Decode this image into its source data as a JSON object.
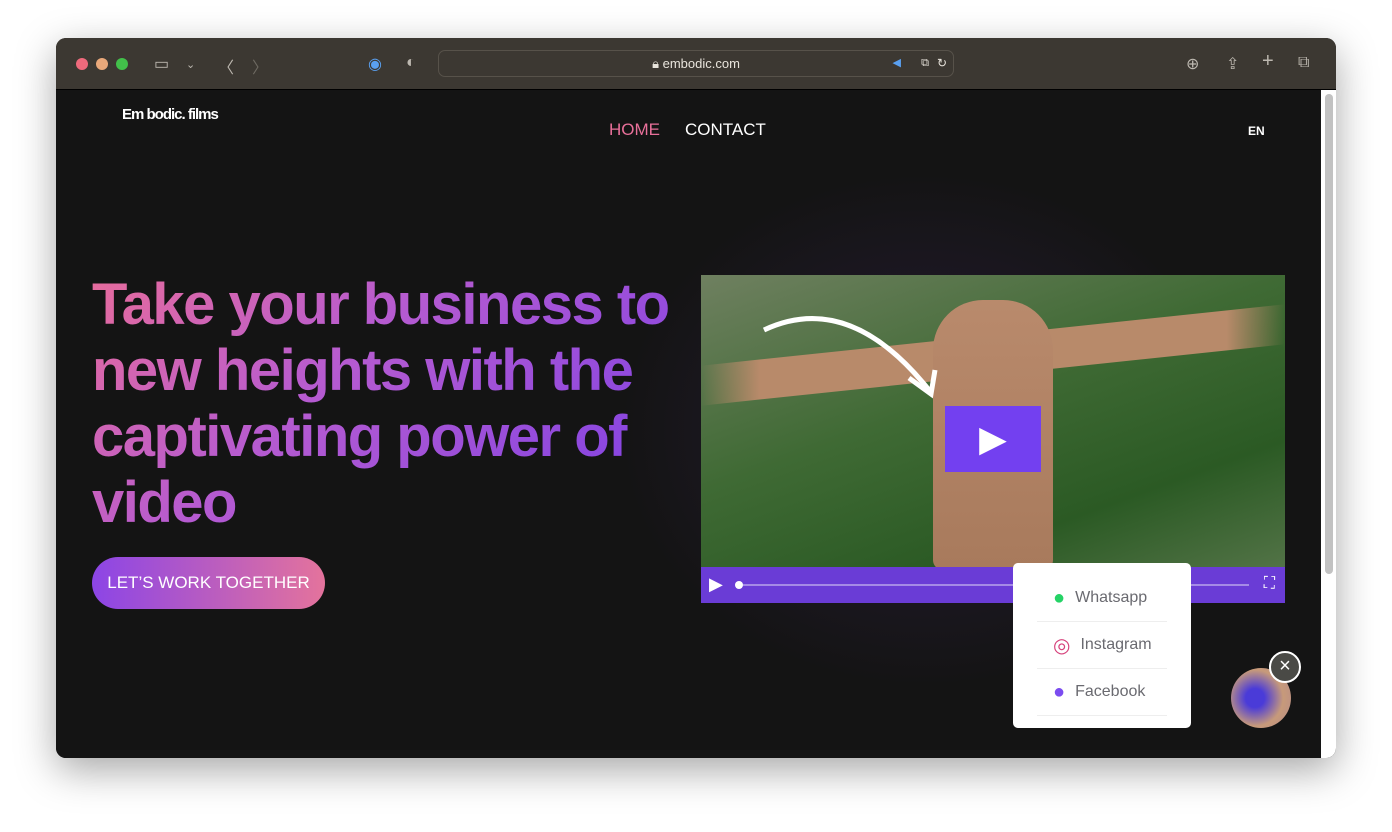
{
  "browser": {
    "url": "embodic.com",
    "icons": [
      "sidebar-icon",
      "chevron-down-icon",
      "back-icon",
      "forward-icon",
      "password-icon",
      "shield-icon",
      "lock-icon",
      "speaker-icon",
      "translate-icon",
      "reload-icon",
      "download-icon",
      "share-icon",
      "new-tab-icon",
      "tabs-icon"
    ]
  },
  "header": {
    "logo": "Em bodic. films",
    "nav": [
      {
        "label": "HOME",
        "active": true
      },
      {
        "label": "CONTACT"
      }
    ],
    "lang": "EN"
  },
  "hero": {
    "headline": "Take your business to new heights with the captivating power of video",
    "cta": "LET’S WORK TOGETHER"
  },
  "contact_popup": {
    "items": [
      {
        "label": "Whatsapp",
        "icon": "whatsapp-icon",
        "color": "#25d366"
      },
      {
        "label": "Instagram",
        "icon": "instagram-icon",
        "color": "#d6417b"
      },
      {
        "label": "Facebook",
        "icon": "messenger-icon",
        "color": "#7b4cf0"
      }
    ]
  },
  "colors": {
    "accent_pink": "#e76c9c",
    "accent_purple": "#7340f0"
  }
}
